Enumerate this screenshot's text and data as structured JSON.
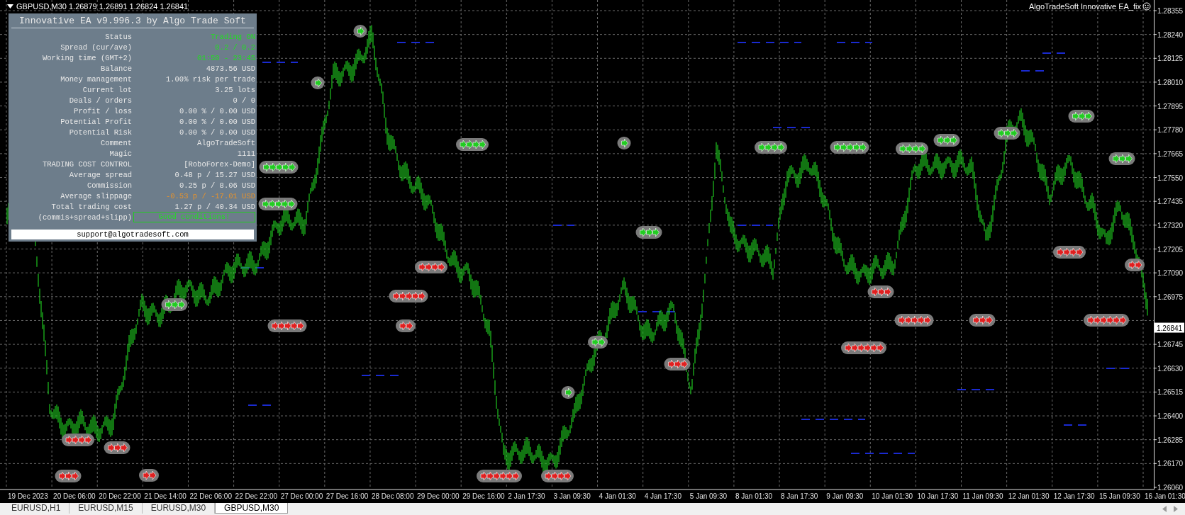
{
  "chart": {
    "symbol_line": "GBPUSD,M30  1.26879 1.26891 1.26824 1.26841",
    "ea_label": "AlgoTradeSoft Innovative EA_fix",
    "current_price": "1.26841",
    "price_axis": [
      "1.28355",
      "1.28240",
      "1.28125",
      "1.28010",
      "1.27895",
      "1.27780",
      "1.27665",
      "1.27550",
      "1.27435",
      "1.27320",
      "1.27205",
      "1.27090",
      "1.26975",
      "1.26745",
      "1.26630",
      "1.26515",
      "1.26400",
      "1.26285",
      "1.26170",
      "1.26060"
    ],
    "time_axis": [
      "19 Dec 2023",
      "20 Dec 06:00",
      "20 Dec 22:00",
      "21 Dec 14:00",
      "22 Dec 06:00",
      "22 Dec 22:00",
      "27 Dec 00:00",
      "27 Dec 16:00",
      "28 Dec 08:00",
      "29 Dec 00:00",
      "29 Dec 16:00",
      "2 Jan 17:30",
      "3 Jan 09:30",
      "4 Jan 01:30",
      "4 Jan 17:30",
      "5 Jan 09:30",
      "8 Jan 01:30",
      "8 Jan 17:30",
      "9 Jan 09:30",
      "10 Jan 01:30",
      "10 Jan 17:30",
      "11 Jan 09:30",
      "12 Jan 01:30",
      "12 Jan 17:30",
      "15 Jan 09:30",
      "16 Jan 01:30"
    ]
  },
  "panel": {
    "title": "Innovative EA v9.996.3 by Algo Trade Soft",
    "rows": [
      {
        "label": "Status",
        "value": "Trading ON",
        "kind": "good"
      },
      {
        "label": "Spread (cur/ave)",
        "value": "0.2 / 0.2",
        "kind": "good"
      },
      {
        "label": "Working time (GMT+2)",
        "value": "01:50 - 23:45",
        "kind": "good"
      },
      {
        "label": "Balance",
        "value": "4873.56 USD",
        "kind": "normal"
      },
      {
        "label": "Money management",
        "value": "1.00% risk per trade",
        "kind": "normal"
      },
      {
        "label": "Current lot",
        "value": "3.25 lots",
        "kind": "normal"
      },
      {
        "label": "Deals / orders",
        "value": "0 / 0",
        "kind": "normal"
      },
      {
        "label": "Profit / loss",
        "value": "0.00 % / 0.00 USD",
        "kind": "normal"
      },
      {
        "label": "Potential Profit",
        "value": "0.00 % / 0.00 USD",
        "kind": "normal"
      },
      {
        "label": "Potential Risk",
        "value": "0.00 % / 0.00 USD",
        "kind": "normal"
      },
      {
        "label": "Comment",
        "value": "AlgoTradeSoft",
        "kind": "normal"
      },
      {
        "label": "Magic",
        "value": "1111",
        "kind": "normal"
      },
      {
        "label": "TRADING COST CONTROL",
        "value": "[RoboForex-Demo]",
        "kind": "normal"
      },
      {
        "label": "Average spread",
        "value": "0.48 p / 15.27 USD",
        "kind": "normal"
      },
      {
        "label": "Commission",
        "value": "0.25 p / 8.06 USD",
        "kind": "normal"
      },
      {
        "label": "Average slippage",
        "value": "-0.53 p / -17.01 USD",
        "kind": "warn"
      },
      {
        "label": "Total trading cost",
        "value": "1.27 p / 40.34 USD",
        "kind": "normal"
      },
      {
        "label": "(commis+spread+slipp)",
        "value": "Good conditions!",
        "kind": "badge"
      }
    ],
    "footer": "support@algotradesoft.com"
  },
  "tabs": [
    {
      "label": "EURUSD,H1",
      "selected": false
    },
    {
      "label": "EURUSD,M15",
      "selected": false
    },
    {
      "label": "EURUSD,M30",
      "selected": false
    },
    {
      "label": "GBPUSD,M30",
      "selected": true
    }
  ]
}
